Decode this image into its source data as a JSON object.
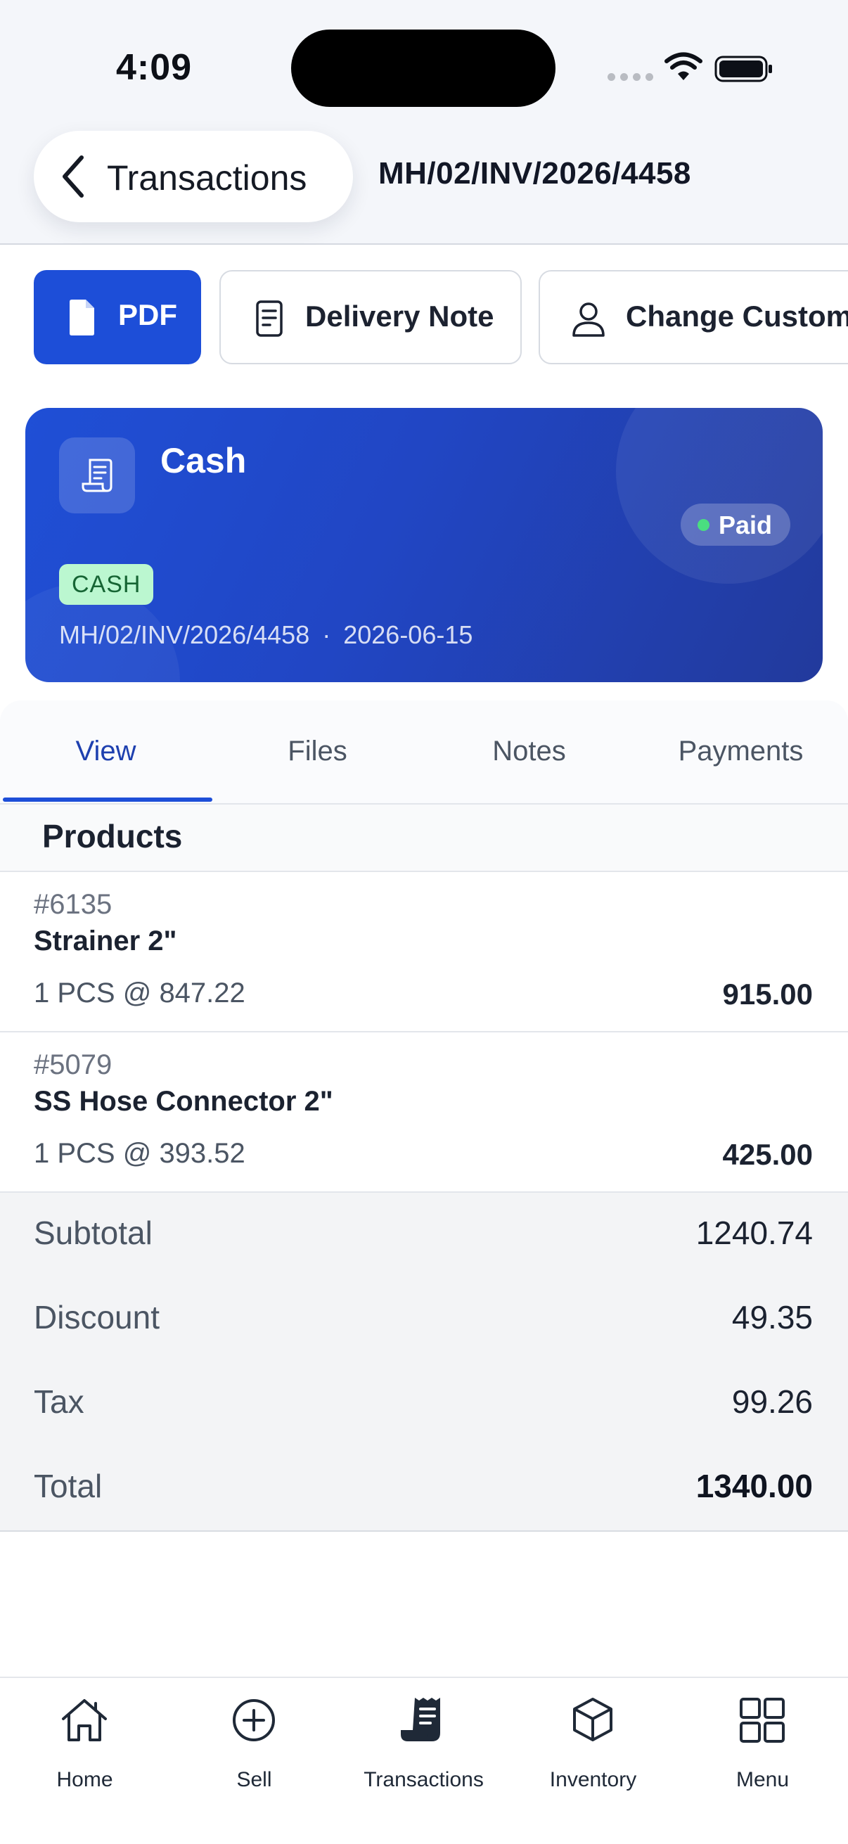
{
  "status_bar": {
    "time": "4:09"
  },
  "header": {
    "back_label": "Transactions",
    "invoice_number": "MH/02/INV/2026/4458"
  },
  "actions": {
    "pdf_label": "PDF",
    "delivery_label": "Delivery Note",
    "customer_label": "Change Custom"
  },
  "hero": {
    "title": "Cash",
    "status": "Paid",
    "payment_badge": "CASH",
    "reference": "MH/02/INV/2026/4458",
    "separator": "·",
    "date": "2026-06-15"
  },
  "tabs": [
    {
      "label": "View"
    },
    {
      "label": "Files"
    },
    {
      "label": "Notes"
    },
    {
      "label": "Payments"
    }
  ],
  "products": {
    "header": "Products",
    "items": [
      {
        "code": "#6135",
        "name": "Strainer 2\"",
        "qty_line": "1 PCS @ 847.22",
        "total": "915.00"
      },
      {
        "code": "#5079",
        "name": "SS Hose Connector 2\"",
        "qty_line": "1 PCS @ 393.52",
        "total": "425.00"
      }
    ]
  },
  "totals": {
    "subtotal_label": "Subtotal",
    "subtotal": "1240.74",
    "discount_label": "Discount",
    "discount": "49.35",
    "tax_label": "Tax",
    "tax": "99.26",
    "total_label": "Total",
    "total": "1340.00"
  },
  "bottom_nav": [
    {
      "label": "Home",
      "icon": "home-icon"
    },
    {
      "label": "Sell",
      "icon": "plus-circle-icon"
    },
    {
      "label": "Transactions",
      "icon": "receipt-icon"
    },
    {
      "label": "Inventory",
      "icon": "box-icon"
    },
    {
      "label": "Menu",
      "icon": "grid-icon"
    }
  ],
  "colors": {
    "primary": "#1d4ed8",
    "hero_gradient_end": "#223a9c",
    "paid_dot": "#4ade80",
    "cash_badge_bg": "#bbf7d0"
  }
}
